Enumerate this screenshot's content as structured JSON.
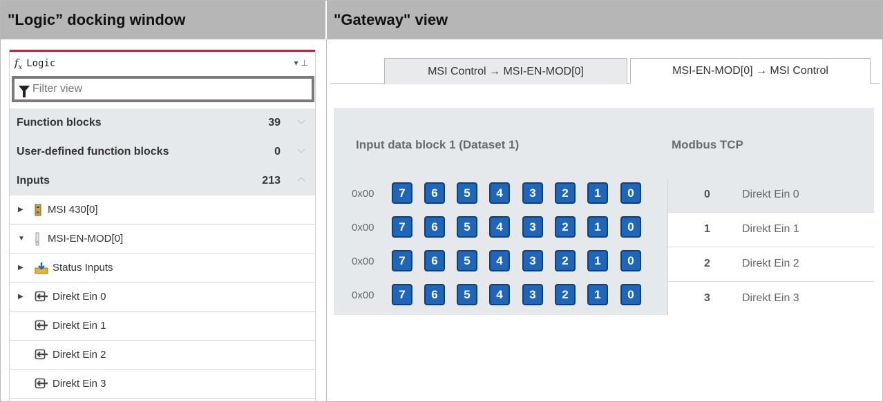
{
  "headers": {
    "left": "\"Logic” docking window",
    "right": "\"Gateway\" view"
  },
  "logic_panel": {
    "title": "Logic",
    "filter_placeholder": "Filter view",
    "accent_color": "#c4203a",
    "categories": [
      {
        "name": "Function blocks",
        "count": "39",
        "expanded": false
      },
      {
        "name": "User-defined function blocks",
        "count": "0",
        "expanded": false
      },
      {
        "name": "Inputs",
        "count": "213",
        "expanded": true
      }
    ],
    "tree": [
      {
        "label": "MSI 430[0]",
        "icon": "module-icon",
        "toggle": "collapsed"
      },
      {
        "label": "MSI-EN-MOD[0]",
        "icon": "module-slim-icon",
        "toggle": "expanded"
      },
      {
        "label": "Status Inputs",
        "icon": "status-inputs-icon",
        "toggle": "collapsed"
      },
      {
        "label": "Direkt Ein 0",
        "icon": "input-arrow-icon",
        "toggle": "collapsed"
      },
      {
        "label": "Direkt Ein 1",
        "icon": "input-arrow-icon",
        "toggle": "none"
      },
      {
        "label": "Direkt Ein 2",
        "icon": "input-arrow-icon",
        "toggle": "none"
      },
      {
        "label": "Direkt Ein 3",
        "icon": "input-arrow-icon",
        "toggle": "none"
      }
    ]
  },
  "gateway": {
    "tabs": [
      {
        "label": "MSI Control → MSI-EN-MOD[0]",
        "active": false
      },
      {
        "label": "MSI-EN-MOD[0] → MSI Control",
        "active": true
      }
    ],
    "block_title": "Input data block 1 (Dataset 1)",
    "protocol_title": "Modbus TCP",
    "bit_color": "#1f66b8",
    "rows": [
      {
        "addr": "0x00",
        "bits": [
          "7",
          "6",
          "5",
          "4",
          "3",
          "2",
          "1",
          "0"
        ]
      },
      {
        "addr": "0x00",
        "bits": [
          "7",
          "6",
          "5",
          "4",
          "3",
          "2",
          "1",
          "0"
        ]
      },
      {
        "addr": "0x00",
        "bits": [
          "7",
          "6",
          "5",
          "4",
          "3",
          "2",
          "1",
          "0"
        ]
      },
      {
        "addr": "0x00",
        "bits": [
          "7",
          "6",
          "5",
          "4",
          "3",
          "2",
          "1",
          "0"
        ]
      }
    ],
    "modbus": [
      {
        "num": "0",
        "name": "Direkt Ein 0",
        "selected": true
      },
      {
        "num": "1",
        "name": "Direkt Ein 1",
        "selected": false
      },
      {
        "num": "2",
        "name": "Direkt Ein 2",
        "selected": false
      },
      {
        "num": "3",
        "name": "Direkt Ein 3",
        "selected": false
      }
    ]
  }
}
